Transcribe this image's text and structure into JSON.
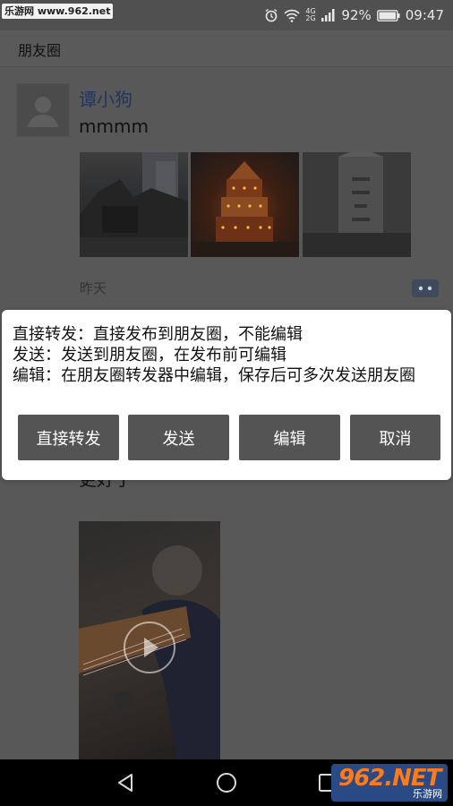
{
  "status_bar": {
    "watermark": "乐游网 www.962.net",
    "network_label": "4G 2G",
    "battery": "92%",
    "time": "09:47"
  },
  "app_bar": {
    "title": "朋友圈"
  },
  "post": {
    "author": "谭小狗",
    "text": "mmmm",
    "time": "昨天"
  },
  "post2": {
    "text": "更好了"
  },
  "dialog": {
    "lines": [
      "直接转发：直接发布到朋友圈，不能编辑",
      "发送：发送到朋友圈，在发布前可编辑",
      "编辑：在朋友圈转发器中编辑，保存后可多次发送朋友圈"
    ],
    "buttons": [
      "直接转发",
      "发送",
      "编辑",
      "取消"
    ]
  },
  "bottom_watermark": {
    "brand": "962.NET",
    "name": "乐游网"
  },
  "icons": {
    "status": [
      "alarm-icon",
      "wifi-icon",
      "signal-icon",
      "battery-icon"
    ],
    "nav": [
      "back-icon",
      "home-icon",
      "recents-icon"
    ],
    "post": [
      "comment-icon",
      "play-icon"
    ]
  }
}
